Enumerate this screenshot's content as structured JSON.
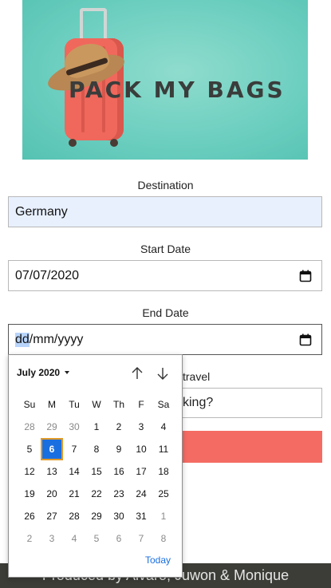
{
  "hero": {
    "title": "PACK MY BAGS"
  },
  "form": {
    "destination": {
      "label": "Destination",
      "value": "Germany"
    },
    "start_date": {
      "label": "Start Date",
      "value": "07/07/2020"
    },
    "end_date": {
      "label": "End Date",
      "seg_day": "dd",
      "seg_rest": "/mm/yyyy"
    },
    "travel": {
      "label_partial": "travel",
      "value_partial": "king?"
    }
  },
  "picker": {
    "month_label": "July 2020",
    "weekdays": [
      "Su",
      "Mo",
      "Tu",
      "We",
      "Th",
      "Fr",
      "Sa"
    ],
    "weekday_display": [
      "Su",
      "M",
      "Tu",
      "W",
      "Th",
      "F",
      "Sa"
    ],
    "days": [
      {
        "d": "28",
        "m": true
      },
      {
        "d": "29",
        "m": true
      },
      {
        "d": "30",
        "m": true
      },
      {
        "d": "1"
      },
      {
        "d": "2"
      },
      {
        "d": "3"
      },
      {
        "d": "4"
      },
      {
        "d": "5"
      },
      {
        "d": "6",
        "sel": true
      },
      {
        "d": "7"
      },
      {
        "d": "8"
      },
      {
        "d": "9"
      },
      {
        "d": "10"
      },
      {
        "d": "11"
      },
      {
        "d": "12"
      },
      {
        "d": "13"
      },
      {
        "d": "14"
      },
      {
        "d": "15"
      },
      {
        "d": "16"
      },
      {
        "d": "17"
      },
      {
        "d": "18"
      },
      {
        "d": "19"
      },
      {
        "d": "20"
      },
      {
        "d": "21"
      },
      {
        "d": "22"
      },
      {
        "d": "23"
      },
      {
        "d": "24"
      },
      {
        "d": "25"
      },
      {
        "d": "26"
      },
      {
        "d": "27"
      },
      {
        "d": "28"
      },
      {
        "d": "29"
      },
      {
        "d": "30"
      },
      {
        "d": "31"
      },
      {
        "d": "1",
        "m": true
      },
      {
        "d": "2",
        "m": true
      },
      {
        "d": "3",
        "m": true
      },
      {
        "d": "4",
        "m": true
      },
      {
        "d": "5",
        "m": true
      },
      {
        "d": "6",
        "m": true
      },
      {
        "d": "7",
        "m": true
      },
      {
        "d": "8",
        "m": true
      }
    ],
    "today_label": "Today"
  },
  "footer": {
    "text": "Produced by Alvaro, Juwon & Monique"
  },
  "colors": {
    "accent": "#1a6fe0",
    "submit": "#f46b63",
    "hero_bg": "#6dcfc0",
    "footer_bg": "#3d3d38"
  }
}
